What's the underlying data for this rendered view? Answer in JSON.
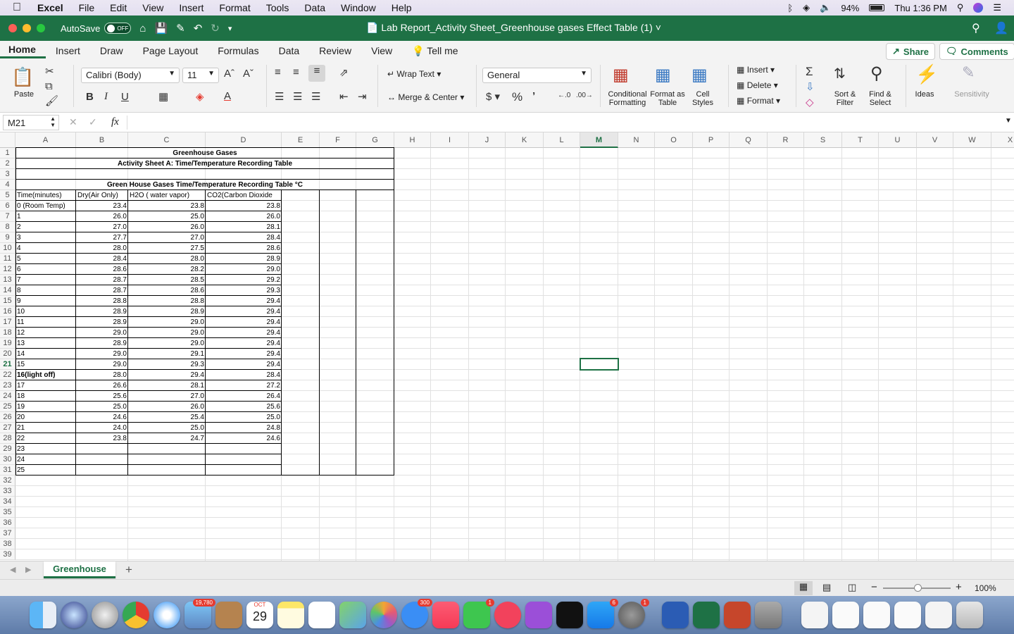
{
  "menubar": {
    "app": "Excel",
    "items": [
      "File",
      "Edit",
      "View",
      "Insert",
      "Format",
      "Tools",
      "Data",
      "Window",
      "Help"
    ],
    "battery": "94%",
    "clock": "Thu 1:36 PM"
  },
  "titlebar": {
    "autosave": "AutoSave",
    "autosave_state": "OFF",
    "title": "Lab Report_Activity Sheet_Greenhouse gases Effect Table (1)"
  },
  "ribbon_tabs": [
    "Home",
    "Insert",
    "Draw",
    "Page Layout",
    "Formulas",
    "Data",
    "Review",
    "View"
  ],
  "tellme": "Tell me",
  "share": "Share",
  "comments": "Comments",
  "ribbon": {
    "paste": "Paste",
    "font_name": "Calibri (Body)",
    "font_size": "11",
    "wrap_text": "Wrap Text",
    "merge_center": "Merge & Center",
    "number_format": "General",
    "conditional": "Conditional Formatting",
    "format_table": "Format as Table",
    "cell_styles": "Cell Styles",
    "insert": "Insert",
    "delete": "Delete",
    "format": "Format",
    "sort_filter": "Sort & Filter",
    "find_select": "Find & Select",
    "ideas": "Ideas",
    "sensitivity": "Sensitivity"
  },
  "formula": {
    "namebox": "M21",
    "fx": "fx",
    "value": ""
  },
  "columns": [
    "A",
    "B",
    "C",
    "D",
    "E",
    "F",
    "G",
    "H",
    "I",
    "J",
    "K",
    "L",
    "M",
    "N",
    "O",
    "P",
    "Q",
    "R",
    "S",
    "T",
    "U",
    "V",
    "W",
    "X"
  ],
  "selected_col": "M",
  "selected_row": 21,
  "sheet": {
    "title1": "Greenhouse Gases",
    "title2": "Activity Sheet A: Time/Temperature Recording Table",
    "title3": "Green House Gases Time/Temperature Recording Table °C",
    "headers": [
      "Time(minutes)",
      "Dry(Air Only)",
      "H2O ( water vapor)",
      "CO2(Carbon Dioxide"
    ],
    "rows": [
      [
        "0 (Room Temp)",
        "23.4",
        "23.8",
        "23.8"
      ],
      [
        "1",
        "26.0",
        "25.0",
        "26.0"
      ],
      [
        "2",
        "27.0",
        "26.0",
        "28.1"
      ],
      [
        "3",
        "27.7",
        "27.0",
        "28.4"
      ],
      [
        "4",
        "28.0",
        "27.5",
        "28.6"
      ],
      [
        "5",
        "28.4",
        "28.0",
        "28.9"
      ],
      [
        "6",
        "28.6",
        "28.2",
        "29.0"
      ],
      [
        "7",
        "28.7",
        "28.5",
        "29.2"
      ],
      [
        "8",
        "28.7",
        "28.6",
        "29.3"
      ],
      [
        "9",
        "28.8",
        "28.8",
        "29.4"
      ],
      [
        "10",
        "28.9",
        "28.9",
        "29.4"
      ],
      [
        "11",
        "28.9",
        "29.0",
        "29.4"
      ],
      [
        "12",
        "29.0",
        "29.0",
        "29.4"
      ],
      [
        "13",
        "28.9",
        "29.0",
        "29.4"
      ],
      [
        "14",
        "29.0",
        "29.1",
        "29.4"
      ],
      [
        "15",
        "29.0",
        "29.3",
        "29.4"
      ],
      [
        "16(light off)",
        "28.0",
        "29.4",
        "28.4"
      ],
      [
        "17",
        "26.6",
        "28.1",
        "27.2"
      ],
      [
        "18",
        "25.6",
        "27.0",
        "26.4"
      ],
      [
        "19",
        "25.0",
        "26.0",
        "25.6"
      ],
      [
        "20",
        "24.6",
        "25.4",
        "25.0"
      ],
      [
        "21",
        "24.0",
        "25.0",
        "24.8"
      ],
      [
        "22",
        "23.8",
        "24.7",
        "24.6"
      ],
      [
        "23",
        "",
        "",
        ""
      ],
      [
        "24",
        "",
        "",
        ""
      ],
      [
        "25",
        "",
        "",
        ""
      ]
    ]
  },
  "sheet_tab": "Greenhouse",
  "zoom": "100%",
  "dock_badges": {
    "photos": "19,780",
    "messages": "300",
    "facetime": "1",
    "appstore": "6",
    "prefs": "1",
    "calendar_month": "OCT",
    "calendar_day": "29"
  }
}
